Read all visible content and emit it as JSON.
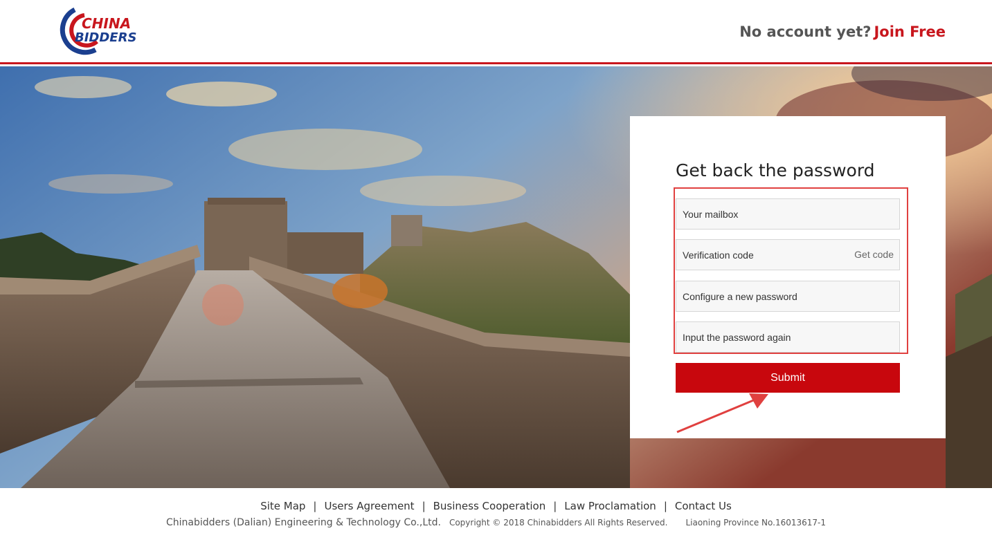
{
  "header": {
    "logo_text_top": "CHINA",
    "logo_text_bottom": "BIDDERS",
    "no_account_text": "No account yet?",
    "join_link": "Join Free"
  },
  "form": {
    "title": "Get back the password",
    "mailbox_placeholder": "Your mailbox",
    "code_placeholder": "Verification code",
    "get_code_label": "Get code",
    "new_password_placeholder": "Configure a new password",
    "confirm_password_placeholder": "Input the password again",
    "submit_label": "Submit"
  },
  "footer": {
    "links": [
      "Site Map",
      "Users Agreement",
      "Business Cooperation",
      "Law Proclamation",
      "Contact Us"
    ],
    "company": "Chinabidders (Dalian) Engineering & Technology Co.,Ltd.",
    "copyright": "Copyright © 2018 Chinabidders All Rights Reserved.",
    "icp": "Liaoning Province No.16013617-1"
  },
  "colors": {
    "brand_red": "#c8161d",
    "submit_red": "#c8070d",
    "logo_blue": "#1b3f8f",
    "annotation_red": "#e0403f"
  }
}
